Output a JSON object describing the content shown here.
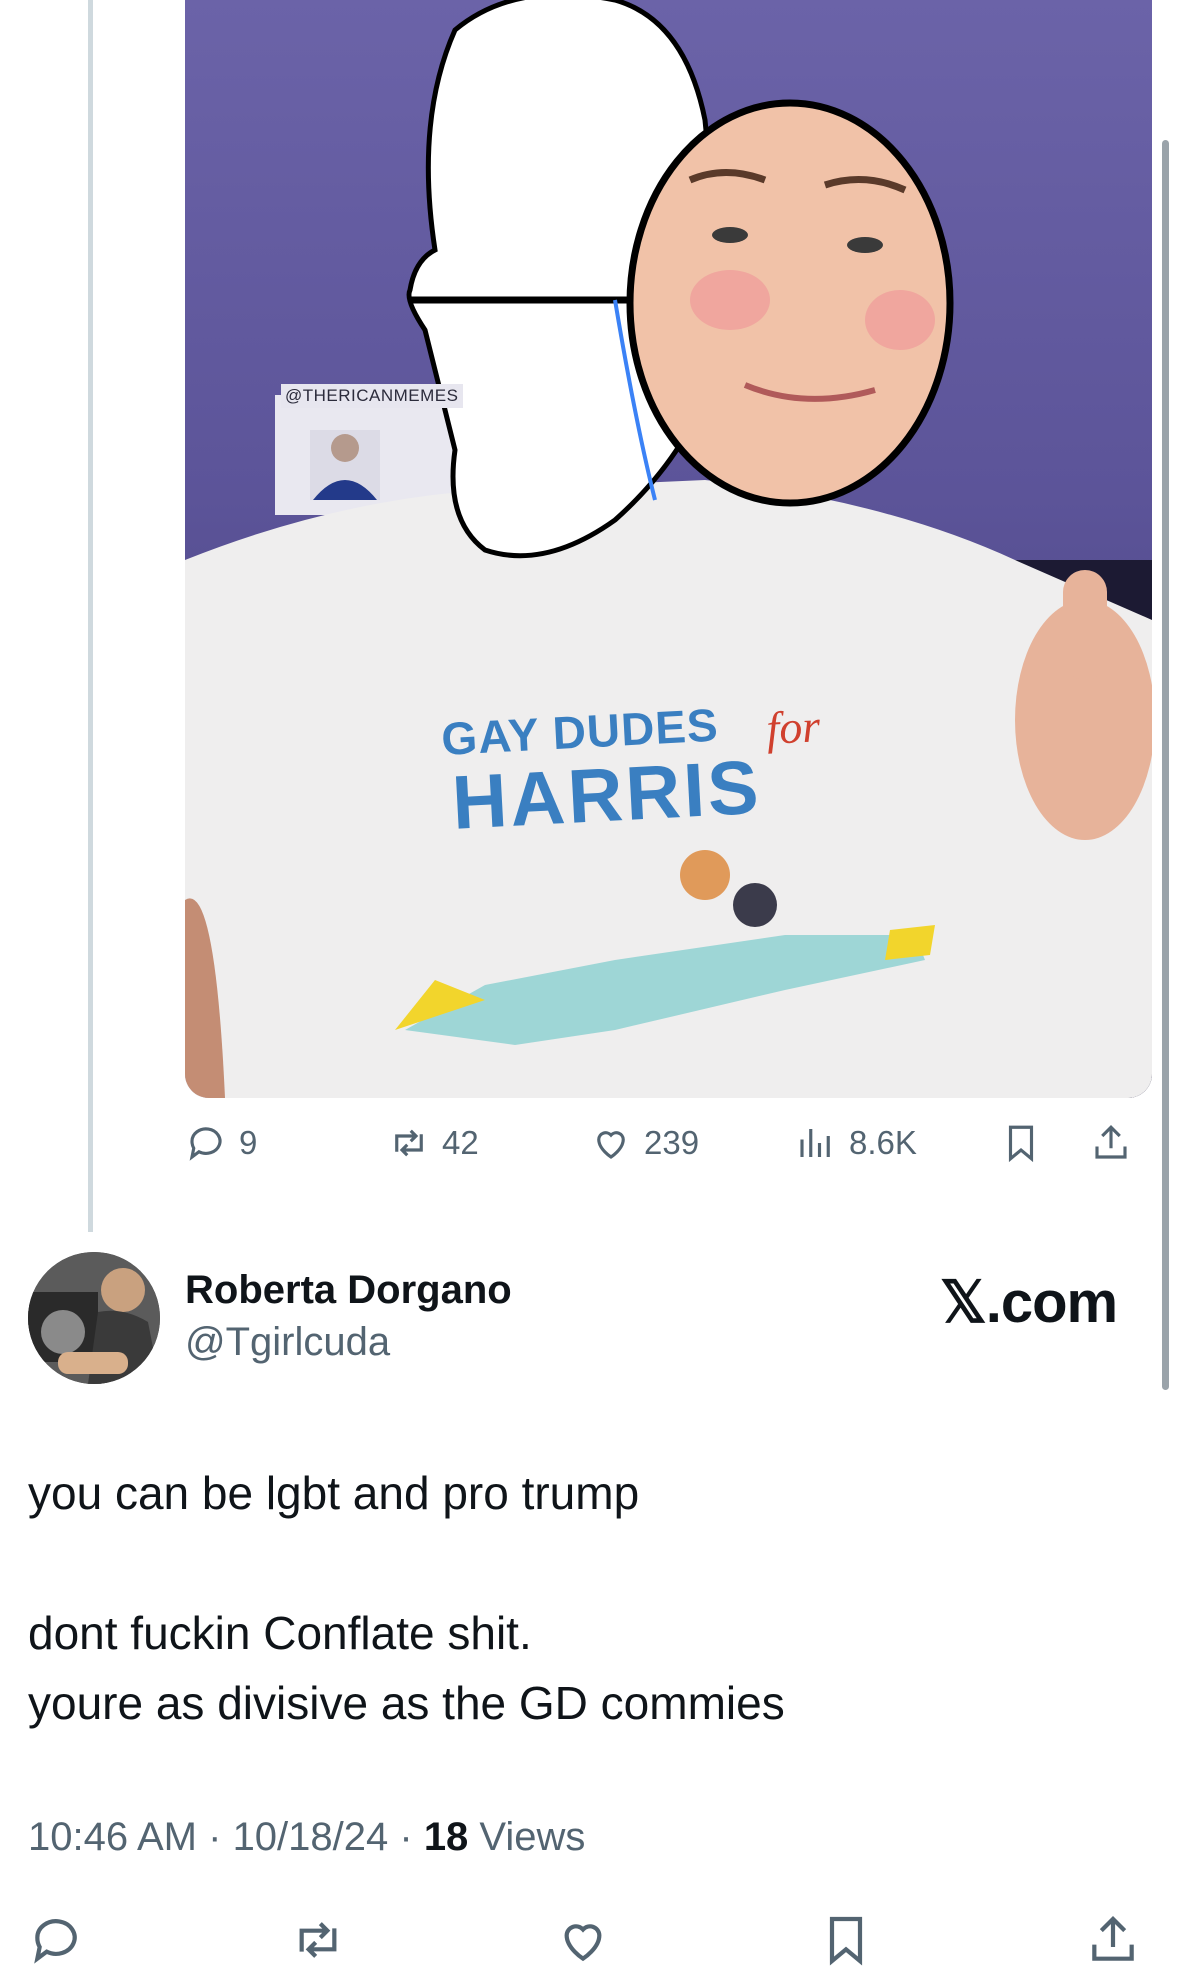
{
  "media": {
    "watermark": "@THERICANMEMES",
    "shirt_line1": "GAY DUDES",
    "shirt_for": "for",
    "shirt_line2": "HARRIS"
  },
  "quoted_actions": {
    "replies": "9",
    "reposts": "42",
    "likes": "239",
    "views": "8.6K"
  },
  "author": {
    "display_name": "Roberta Dorgano",
    "handle": "@Tgirlcuda"
  },
  "brand": "𝕏.com",
  "tweet": {
    "line1": "you can be lgbt and pro trump",
    "line2": "dont fuckin Conflate shit.",
    "line3": "youre as divisive as the GD commies"
  },
  "meta": {
    "time": "10:46 AM",
    "separator1": " · ",
    "date": "10/18/24",
    "separator2": " · ",
    "views_count": "18",
    "views_label": " Views"
  },
  "colors": {
    "text_primary": "#0f1419",
    "text_secondary": "#536471",
    "thread_line": "#cfd9de",
    "shirt_blue": "#3a7fc1",
    "shirt_red": "#d0402e"
  }
}
